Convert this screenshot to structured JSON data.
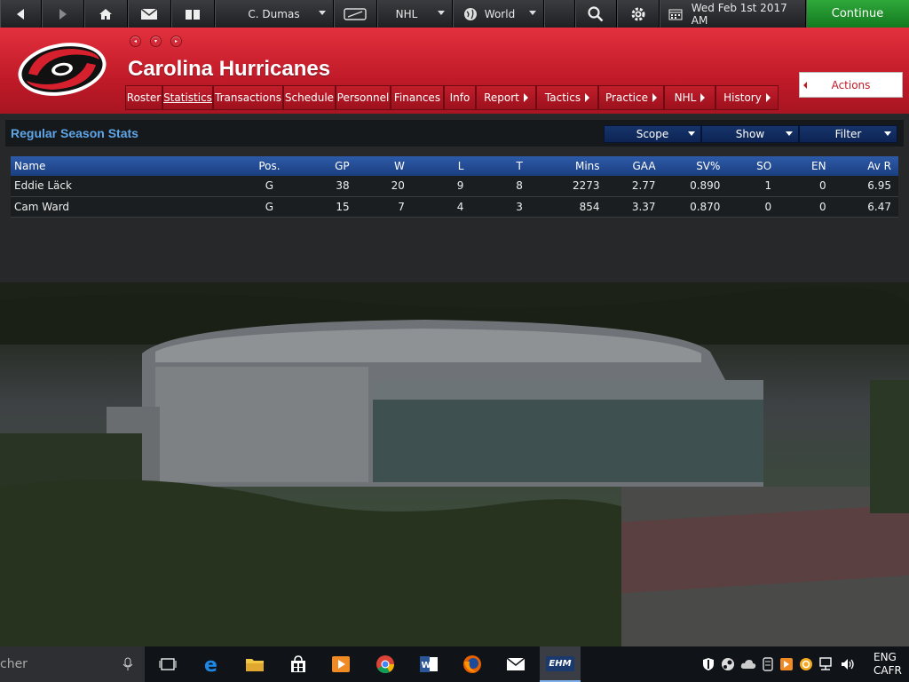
{
  "topbar": {
    "manager": "C. Dumas",
    "league": "NHL",
    "region": "World",
    "date": "Wed Feb 1st 2017 AM",
    "continue_label": "Continue"
  },
  "header": {
    "team_name": "Carolina Hurricanes",
    "actions_label": "Actions",
    "tabs": [
      {
        "label": "Roster"
      },
      {
        "label": "Statistics"
      },
      {
        "label": "Transactions"
      },
      {
        "label": "Schedule"
      },
      {
        "label": "Personnel"
      },
      {
        "label": "Finances"
      },
      {
        "label": "Info"
      },
      {
        "label": "Report"
      },
      {
        "label": "Tactics"
      },
      {
        "label": "Practice"
      },
      {
        "label": "NHL"
      },
      {
        "label": "History"
      }
    ]
  },
  "panel": {
    "title": "Regular Season Stats",
    "scope_label": "Scope",
    "show_label": "Show",
    "filter_label": "Filter"
  },
  "table": {
    "headers": [
      "Name",
      "Pos.",
      "GP",
      "W",
      "L",
      "T",
      "Mins",
      "GAA",
      "SV%",
      "SO",
      "EN",
      "Av R"
    ],
    "rows": [
      [
        "Eddie Läck",
        "G",
        "38",
        "20",
        "9",
        "8",
        "2273",
        "2.77",
        "0.890",
        "1",
        "0",
        "6.95"
      ],
      [
        "Cam Ward",
        "G",
        "15",
        "7",
        "4",
        "3",
        "854",
        "3.37",
        "0.870",
        "0",
        "0",
        "6.47"
      ]
    ]
  },
  "taskbar": {
    "search_text": "cher",
    "lang_top": "ENG",
    "lang_bottom": "CAFR",
    "ehm_label": "EHM"
  },
  "colors": {
    "header_red": "#c01a28",
    "title_blue": "#5fa6e8",
    "goalie_pos": "#e5e021",
    "continue_green": "#1f8f2b"
  }
}
